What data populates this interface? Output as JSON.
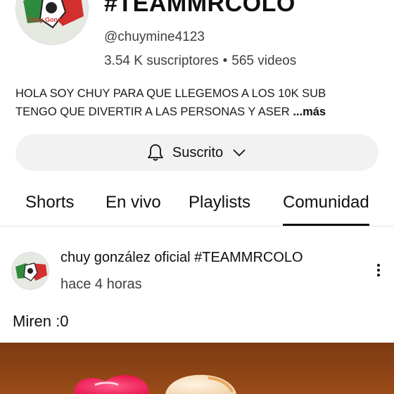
{
  "channel": {
    "avatar_text": "Chuy González",
    "title": "#TEAMMRCOLO",
    "handle": "@chuymine4123",
    "subscribers": "3.54 K suscriptores",
    "separator": "•",
    "videos": "565 videos",
    "description_line1": "HOLA SOY CHUY PARA QUE LLEGEMOS A LOS 10K SUB",
    "description_line2": "TENGO QUE DIVERTIR A LAS PERSONAS Y ASER",
    "description_fade": "…",
    "description_more": "...más"
  },
  "subscribe": {
    "label": "Suscrito",
    "bell_icon": "bell-icon",
    "chevron_icon": "chevron-down-icon"
  },
  "tabs": [
    {
      "label": "Shorts"
    },
    {
      "label": "En vivo"
    },
    {
      "label": "Playlists"
    },
    {
      "label": "Comunidad",
      "active": true
    }
  ],
  "post": {
    "author": "chuy gonzález oficial #TEAMMRCOLO",
    "time": "hace 4 horas",
    "text": "Miren :0",
    "menu_icon": "more-vert-icon"
  },
  "colors": {
    "image_bg": "#8e4416",
    "button_bg": "#f2f2f2"
  }
}
